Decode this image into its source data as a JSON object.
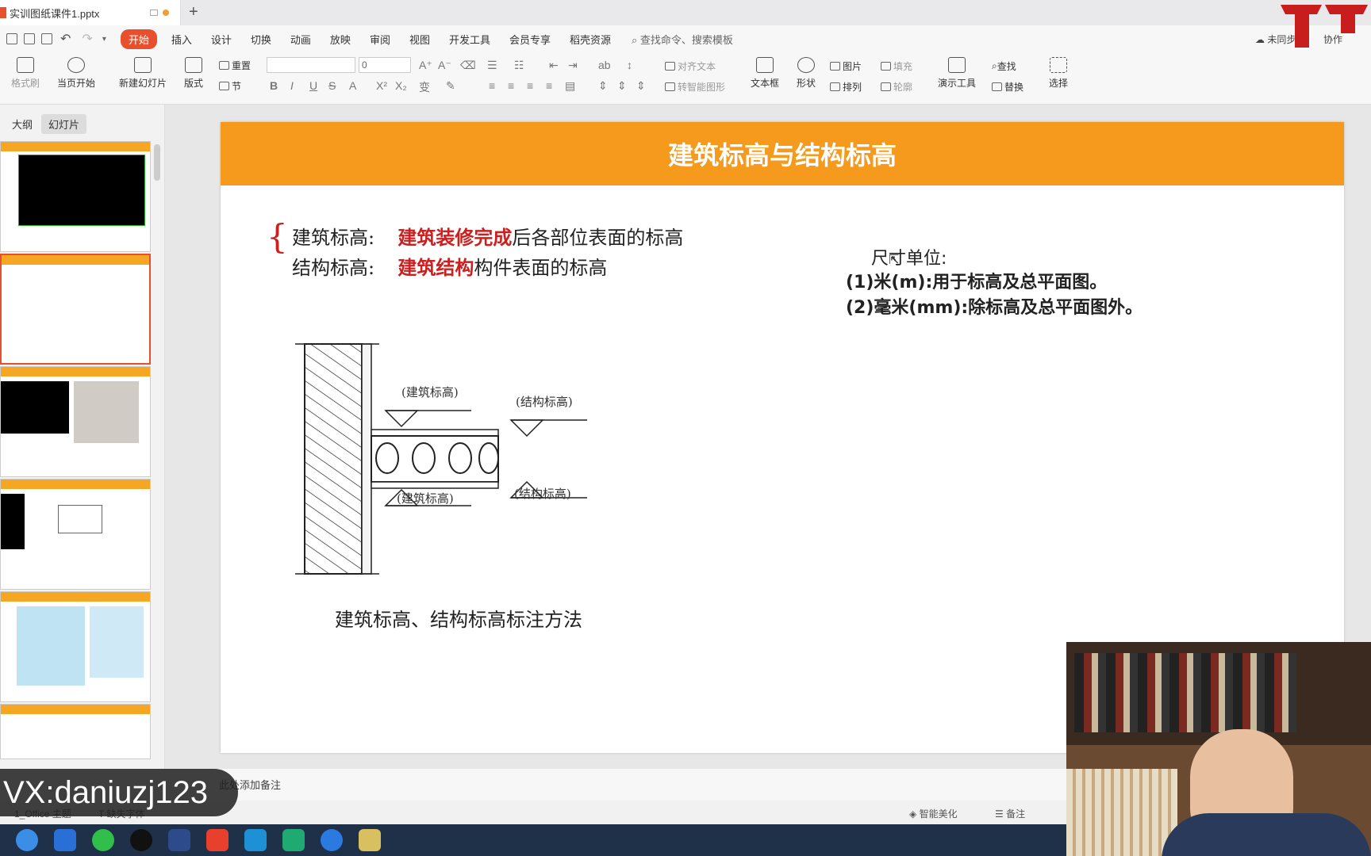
{
  "titlebar": {
    "doc_name": "实训图纸课件1.pptx"
  },
  "menu": {
    "items": [
      "开始",
      "插入",
      "设计",
      "切换",
      "动画",
      "放映",
      "审阅",
      "视图",
      "开发工具",
      "会员专享",
      "稻壳资源"
    ],
    "search": "查找命令、搜索模板",
    "sync": "未同步",
    "collab": "协作"
  },
  "ribbon": {
    "format_brush": "格式刷",
    "play_from": "当页开始",
    "new_slide": "新建幻灯片",
    "layout": "版式",
    "reset": "重置",
    "section": "节",
    "font_size": "0",
    "align_text": "对齐文本",
    "smart_shape": "转智能图形",
    "textbox": "文本框",
    "shape": "形状",
    "picture": "图片",
    "arrange": "排列",
    "fill": "填充",
    "outline": "轮廓",
    "presentation_tools": "演示工具",
    "find": "查找",
    "replace": "替换",
    "select": "选择"
  },
  "panel": {
    "outline_tab": "大纲",
    "slides_tab": "幻灯片"
  },
  "slide": {
    "title": "建筑标高与结构标高",
    "row1_label": "建筑标高:",
    "row1_red": "建筑装修完成",
    "row1_rest": "后各部位表面的标高",
    "row2_label": "结构标高:",
    "row2_red": "建筑结构",
    "row2_rest": "构件表面的标高",
    "unit_title": "尺寸单位:",
    "unit_1": "(1)米(m):用于标高及总平面图。",
    "unit_2": "(2)毫米(mm):除标高及总平面图外。",
    "diagram": {
      "arch_top": "(建筑标高)",
      "struct_top": "(结构标高)",
      "arch_bottom": "(建筑标高)",
      "struct_bottom": "(结构标高)"
    },
    "caption": "建筑标高、结构标高标注方法"
  },
  "notes_placeholder": "此处添加备注",
  "status": {
    "theme": "1_Office 主题",
    "missing_font": "缺失字体",
    "beautify": "智能美化",
    "notes": "备注"
  },
  "overlay": {
    "wechat": "VX:daniuzj123"
  },
  "colors": {
    "accent": "#e8502d",
    "slide_header": "#f59a1c",
    "red_text": "#cc2020"
  }
}
